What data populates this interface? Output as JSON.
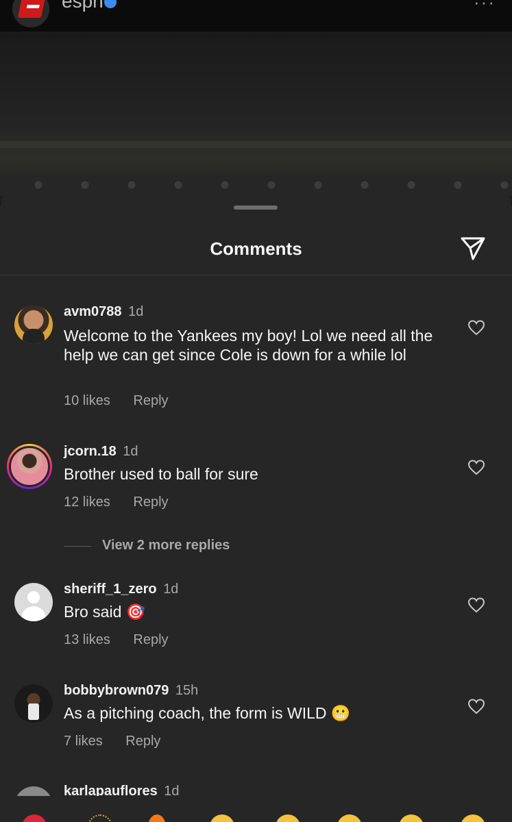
{
  "post": {
    "username": "espn",
    "verified": true,
    "more_label": "···"
  },
  "sheet": {
    "title": "Comments"
  },
  "comments": [
    {
      "username": "avm0788",
      "time": "1d",
      "text": "Welcome to the Yankees my boy! Lol we need all the help we can get since Cole is down for a while lol",
      "likes": "10 likes",
      "reply": "Reply"
    },
    {
      "username": "jcorn.18",
      "time": "1d",
      "text": "Brother used to ball for sure",
      "likes": "12 likes",
      "reply": "Reply",
      "view_replies": "View 2 more replies"
    },
    {
      "username": "sheriff_1_zero",
      "time": "1d",
      "text": "Bro said 🎯",
      "likes": "13 likes",
      "reply": "Reply"
    },
    {
      "username": "bobbybrown079",
      "time": "15h",
      "text": "As a pitching coach, the form is WILD 😬",
      "likes": "7 likes",
      "reply": "Reply"
    },
    {
      "username": "karlapauflores",
      "time": "1d"
    }
  ],
  "reactions": [
    "❤️",
    "🙌",
    "🔥",
    "👏",
    "😢",
    "😍",
    "😮",
    "😂"
  ],
  "icons": {
    "send": "send-icon",
    "heart": "heart-outline-icon"
  },
  "colors": {
    "sheet_bg": "#262626",
    "text_primary": "#f5f5f5",
    "text_secondary": "#a8a8a8"
  }
}
